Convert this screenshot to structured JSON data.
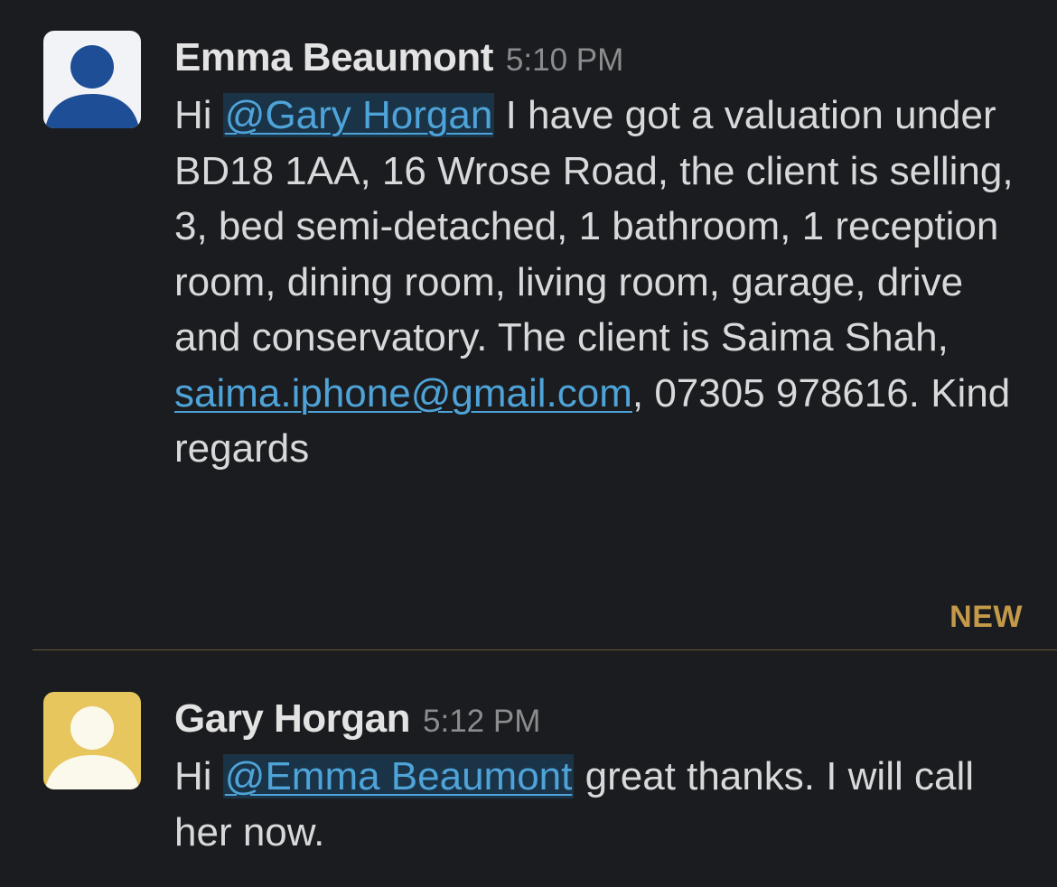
{
  "messages": [
    {
      "author": "Emma Beaumont",
      "time": "5:10 PM",
      "avatar_icon": "user-silhouette-icon",
      "avatar_bg": "#f2f3f6",
      "avatar_fg": "#1e4e96",
      "text": {
        "prefix": "Hi ",
        "mention": "@Gary Horgan",
        "body": " I have got a valuation under BD18 1AA, 16 Wrose Road, the client is selling, 3, bed semi-detached, 1 bathroom, 1 reception room, dining room, living room, garage, drive and conservatory. The client is Saima Shah, ",
        "email": "saima.iphone@gmail.com",
        "suffix": ", 07305 978616. Kind regards"
      }
    },
    {
      "author": "Gary Horgan",
      "time": "5:12 PM",
      "avatar_icon": "user-silhouette-icon",
      "avatar_bg": "#e8c65e",
      "avatar_fg": "#fbf8ec",
      "text": {
        "prefix": "Hi ",
        "mention": "@Emma Beaumont",
        "body": " great thanks. I will call her now."
      }
    }
  ],
  "divider": {
    "label": "NEW",
    "color": "#c49a4a"
  },
  "colors": {
    "background": "#1b1c1f",
    "link": "#4ea3d8",
    "mention_bg": "#1b3347"
  }
}
